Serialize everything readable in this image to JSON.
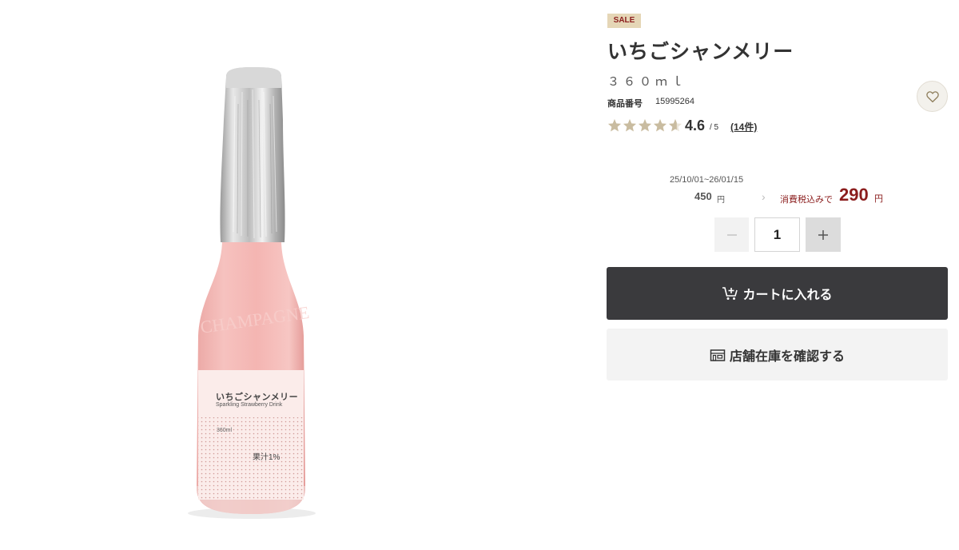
{
  "product": {
    "badge": "SALE",
    "title": "いちごシャンメリー",
    "volume": "３６０ｍｌ",
    "code_label": "商品番号",
    "code_value": "15995264",
    "image_label": {
      "title": "いちごシャンメリー",
      "subtitle": "Sparkling Strawberry Drink",
      "volume": "360ml",
      "juice": "果汁1%"
    }
  },
  "rating": {
    "value": "4.6",
    "max": "/ 5",
    "score": 4.6,
    "stars_total": 5,
    "count_label": "(14件)",
    "star_color": "#c9bca0"
  },
  "price": {
    "period": "25/10/01~26/01/15",
    "original": "450",
    "original_unit": "円",
    "arrow": "›",
    "tax_label": "消費税込みで",
    "sale": "290",
    "sale_unit": "円",
    "sale_color": "#8b1d1d"
  },
  "quantity": {
    "value": "1"
  },
  "actions": {
    "cart_label": "カートに入れる",
    "store_label": "店舗在庫を確認する"
  },
  "icons": {
    "favorite": "heart-outline-icon",
    "minus": "minus-icon",
    "plus": "plus-icon",
    "cart": "cart-add-icon",
    "store": "store-icon"
  }
}
